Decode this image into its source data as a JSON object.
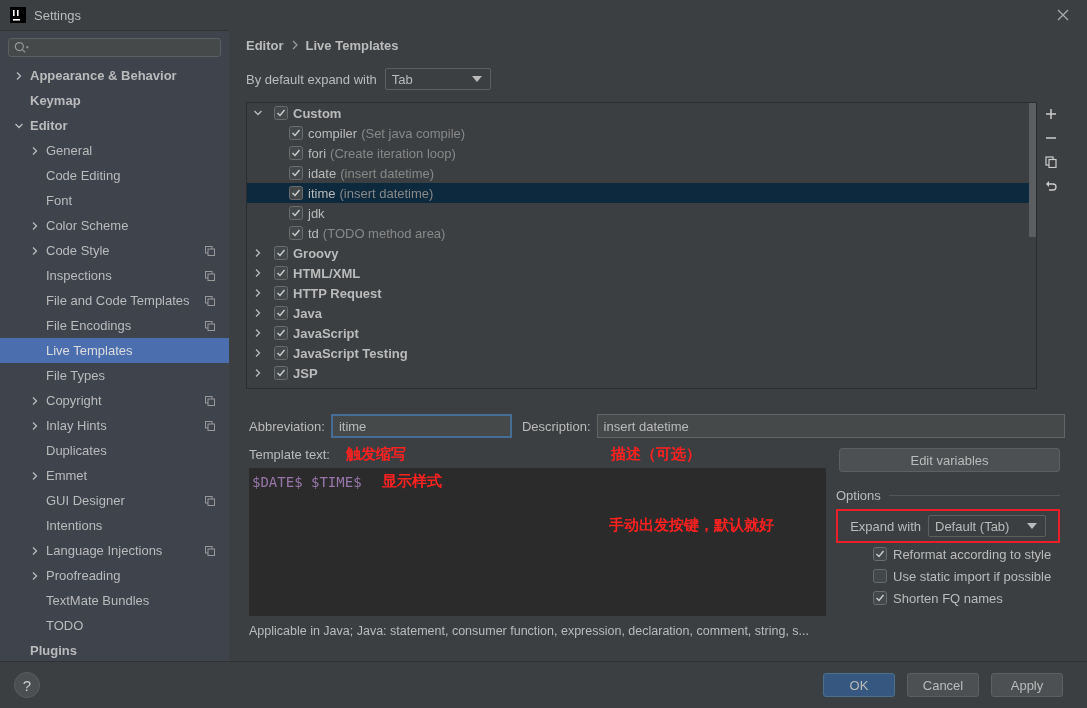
{
  "window": {
    "title": "Settings"
  },
  "sidebar": {
    "items": [
      {
        "label": "Appearance & Behavior",
        "expanded": false,
        "selected": false
      },
      {
        "label": "Keymap",
        "selected": false
      },
      {
        "label": "Editor",
        "expanded": true,
        "selected": false,
        "children": [
          {
            "label": "General",
            "expanded": false,
            "selected": false
          },
          {
            "label": "Code Editing",
            "selected": false
          },
          {
            "label": "Font",
            "selected": false
          },
          {
            "label": "Color Scheme",
            "expanded": false,
            "selected": false
          },
          {
            "label": "Code Style",
            "expanded": false,
            "selected": false,
            "project_scope": true
          },
          {
            "label": "Inspections",
            "selected": false,
            "project_scope": true
          },
          {
            "label": "File and Code Templates",
            "selected": false,
            "project_scope": true
          },
          {
            "label": "File Encodings",
            "selected": false,
            "project_scope": true
          },
          {
            "label": "Live Templates",
            "selected": true
          },
          {
            "label": "File Types",
            "selected": false
          },
          {
            "label": "Copyright",
            "expanded": false,
            "selected": false,
            "project_scope": true
          },
          {
            "label": "Inlay Hints",
            "expanded": false,
            "selected": false,
            "project_scope": true
          },
          {
            "label": "Duplicates",
            "selected": false
          },
          {
            "label": "Emmet",
            "expanded": false,
            "selected": false
          },
          {
            "label": "GUI Designer",
            "selected": false,
            "project_scope": true
          },
          {
            "label": "Intentions",
            "selected": false
          },
          {
            "label": "Language Injections",
            "expanded": false,
            "selected": false,
            "project_scope": true
          },
          {
            "label": "Proofreading",
            "expanded": false,
            "selected": false
          },
          {
            "label": "TextMate Bundles",
            "selected": false
          },
          {
            "label": "TODO",
            "selected": false
          }
        ]
      },
      {
        "label": "Plugins",
        "selected": false
      }
    ]
  },
  "breadcrumb": [
    "Editor",
    "Live Templates"
  ],
  "default_expand": {
    "label": "By default expand with",
    "value": "Tab"
  },
  "templates": [
    {
      "name": "Custom",
      "checked": true,
      "expanded": true,
      "children": [
        {
          "name": "compiler",
          "description": "(Set java compile)",
          "checked": true,
          "selected": false
        },
        {
          "name": "fori",
          "description": "(Create iteration loop)",
          "checked": true,
          "selected": false
        },
        {
          "name": "idate",
          "description": "(insert datetime)",
          "checked": true,
          "selected": false
        },
        {
          "name": "itime",
          "description": "(insert datetime)",
          "checked": true,
          "selected": true
        },
        {
          "name": "jdk",
          "checked": true,
          "selected": false
        },
        {
          "name": "td",
          "description": "(TODO method area)",
          "checked": true,
          "selected": false
        }
      ]
    },
    {
      "name": "Groovy",
      "checked": true,
      "expanded": false
    },
    {
      "name": "HTML/XML",
      "checked": true,
      "expanded": false
    },
    {
      "name": "HTTP Request",
      "checked": true,
      "expanded": false
    },
    {
      "name": "Java",
      "checked": true,
      "expanded": false
    },
    {
      "name": "JavaScript",
      "checked": true,
      "expanded": false
    },
    {
      "name": "JavaScript Testing",
      "checked": true,
      "expanded": false
    },
    {
      "name": "JSP",
      "checked": true,
      "expanded": false
    }
  ],
  "abbreviation": {
    "label": "Abbreviation:",
    "value": "itime"
  },
  "description": {
    "label": "Description:",
    "value": "insert datetime"
  },
  "template_text": {
    "label": "Template text:",
    "value": "$DATE$ $TIME$"
  },
  "edit_variables": "Edit variables",
  "options": {
    "title": "Options",
    "expand_with": {
      "label": "Expand with",
      "value": "Default (Tab)"
    },
    "checkboxes": [
      {
        "label": "Reformat according to style",
        "checked": true
      },
      {
        "label": "Use static import if possible",
        "checked": false
      },
      {
        "label": "Shorten FQ names",
        "checked": true
      }
    ]
  },
  "applicable": "Applicable in Java; Java: statement, consumer function, expression, declaration, comment, string, s...",
  "annotations": {
    "abbreviation": "触发缩写",
    "description": "描述（可选）",
    "template_text": "显示样式",
    "expand_with": "手动出发按键，默认就好"
  },
  "help": "?",
  "buttons": [
    "OK",
    "Cancel",
    "Apply"
  ]
}
